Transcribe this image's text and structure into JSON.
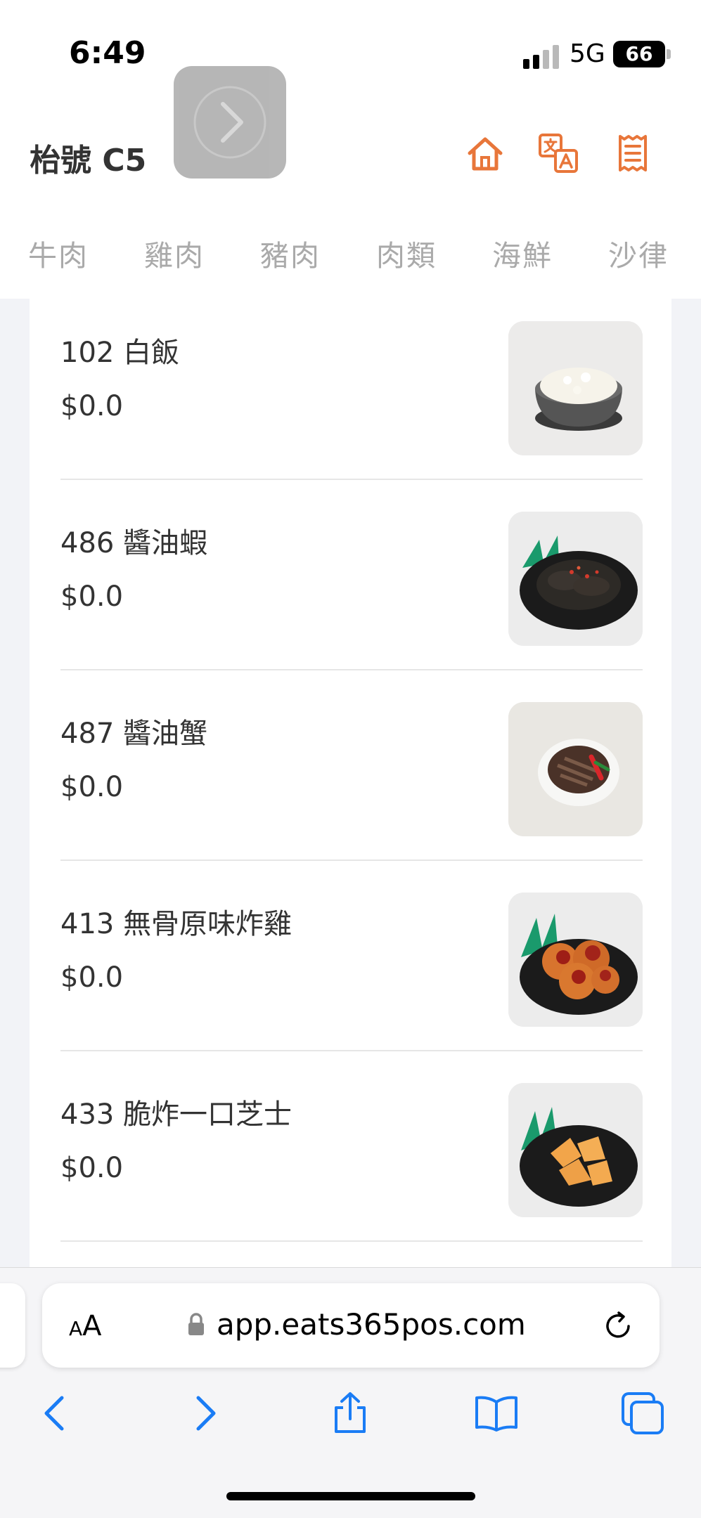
{
  "status_bar": {
    "time": "6:49",
    "network": "5G",
    "battery": "66"
  },
  "header": {
    "title": "枱號 C5",
    "icons": [
      "home-icon",
      "translate-icon",
      "receipt-icon"
    ],
    "accent_color": "#e8763a"
  },
  "categories": [
    "牛肉",
    "雞肉",
    "豬肉",
    "肉類",
    "海鮮",
    "沙律"
  ],
  "menu_items": [
    {
      "name": "102 白飯",
      "price": "$0.0",
      "image": "rice-bowl"
    },
    {
      "name": "486 醬油蝦",
      "price": "$0.0",
      "image": "soy-shrimp"
    },
    {
      "name": "487 醬油蟹",
      "price": "$0.0",
      "image": "soy-crab"
    },
    {
      "name": "413 無骨原味炸雞",
      "price": "$0.0",
      "image": "fried-chicken"
    },
    {
      "name": "433 脆炸一口芝士",
      "price": "$0.0",
      "image": "fried-cheese"
    }
  ],
  "browser": {
    "text_size_label": "AA",
    "url": "app.eats365pos.com",
    "nav_color": "#1a7cf5"
  }
}
